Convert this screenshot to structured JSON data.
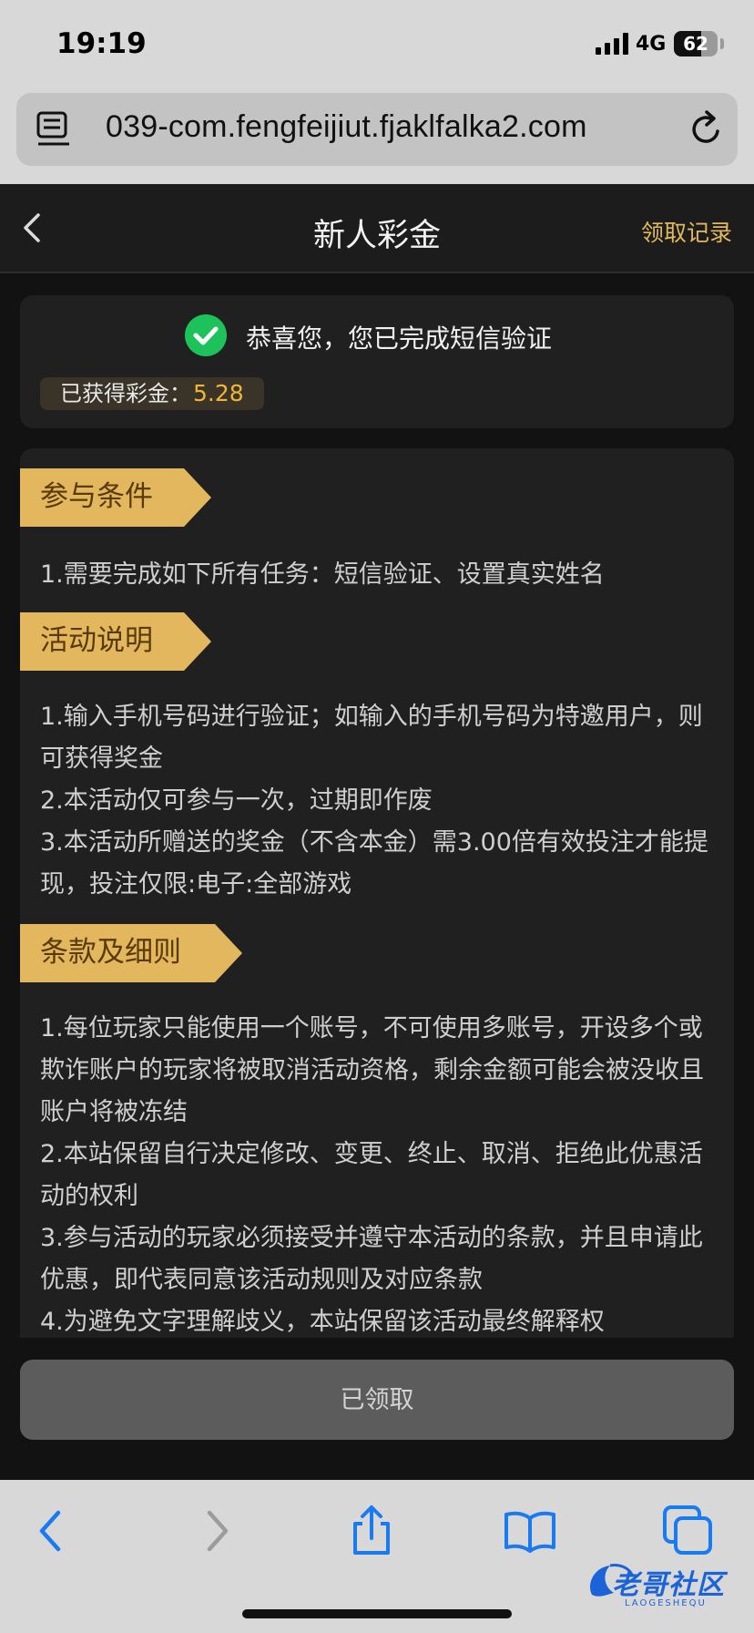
{
  "status_bar": {
    "time": "19:19",
    "network": "4G",
    "battery": "62"
  },
  "browser": {
    "url": "039-com.fengfeijiut.fjaklfalka2.com"
  },
  "header": {
    "title": "新人彩金",
    "action": "领取记录"
  },
  "success": {
    "message": "恭喜您，您已完成短信验证",
    "reward_label": "已获得彩金：",
    "reward_value": "5.28"
  },
  "sections": [
    {
      "title": "参与条件",
      "lines": [
        "1.需要完成如下所有任务：短信验证、设置真实姓名"
      ]
    },
    {
      "title": "活动说明",
      "lines": [
        "1.输入手机号码进行验证；如输入的手机号码为特邀用户，则可获得奖金",
        "2.本活动仅可参与一次，过期即作废",
        "3.本活动所赠送的奖金（不含本金）需3.00倍有效投注才能提现，投注仅限:电子:全部游戏"
      ]
    },
    {
      "title": "条款及细则",
      "lines": [
        "1.每位玩家只能使用一个账号，不可使用多账号，开设多个或欺诈账户的玩家将被取消活动资格，剩余金额可能会被没收且账户将被冻结",
        "2.本站保留自行决定修改、变更、终止、取消、拒绝此优惠活动的权利",
        "3.参与活动的玩家必须接受并遵守本活动的条款，并且申请此优惠，即代表同意该活动规则及对应条款",
        "4.为避免文字理解歧义，本站保留该活动最终解释权"
      ]
    }
  ],
  "claim_button": {
    "label": "已领取"
  },
  "watermark": {
    "text": "老哥社区",
    "sub": "LAOGESHEQU"
  },
  "colors": {
    "accent": "#e2b75e",
    "reward": "#f0b43a",
    "safari_blue": "#1a7bf0"
  }
}
